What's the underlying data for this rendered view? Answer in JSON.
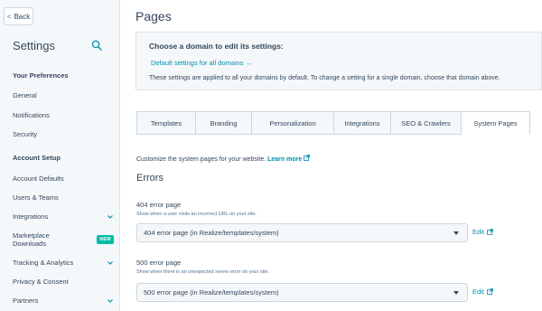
{
  "sidebar": {
    "back_label": "Back",
    "title": "Settings",
    "sections": [
      {
        "heading": "Your Preferences",
        "items": [
          {
            "label": "General"
          },
          {
            "label": "Notifications"
          },
          {
            "label": "Security"
          }
        ]
      },
      {
        "heading": "Account Setup",
        "items": [
          {
            "label": "Account Defaults"
          },
          {
            "label": "Users & Teams"
          },
          {
            "label": "Integrations"
          },
          {
            "label": "Marketplace Downloads",
            "badge": "NEW"
          },
          {
            "label": "Tracking & Analytics"
          },
          {
            "label": "Privacy & Consent"
          },
          {
            "label": "Partners"
          }
        ]
      }
    ]
  },
  "main": {
    "page_title": "Pages",
    "domain_box": {
      "title": "Choose a domain to edit its settings:",
      "link": "Default settings for all domains →",
      "description": "These settings are applied to all your domains by default. To change a setting for a single domain, choose that domain above."
    },
    "tabs": [
      {
        "label": "Templates"
      },
      {
        "label": "Branding"
      },
      {
        "label": "Personalization"
      },
      {
        "label": "Integrations"
      },
      {
        "label": "SEO & Crawlers"
      },
      {
        "label": "System Pages",
        "active": true
      }
    ],
    "intro_text": "Customize the system pages for your website.",
    "learn_more": "Learn more",
    "section_title": "Errors",
    "fields": [
      {
        "label": "404 error page",
        "help": "Show when a user visits an incorrect URL on your site.",
        "value": "404 error page (in Realize/templates/system)",
        "edit": "Edit"
      },
      {
        "label": "500 error page",
        "help": "Show when there is an unexpected server error on your site.",
        "value": "500 error page (in Realize/templates/system)",
        "edit": "Edit"
      }
    ]
  },
  "colors": {
    "link": "#0091ae",
    "badge": "#00bda5",
    "text": "#33475b"
  }
}
